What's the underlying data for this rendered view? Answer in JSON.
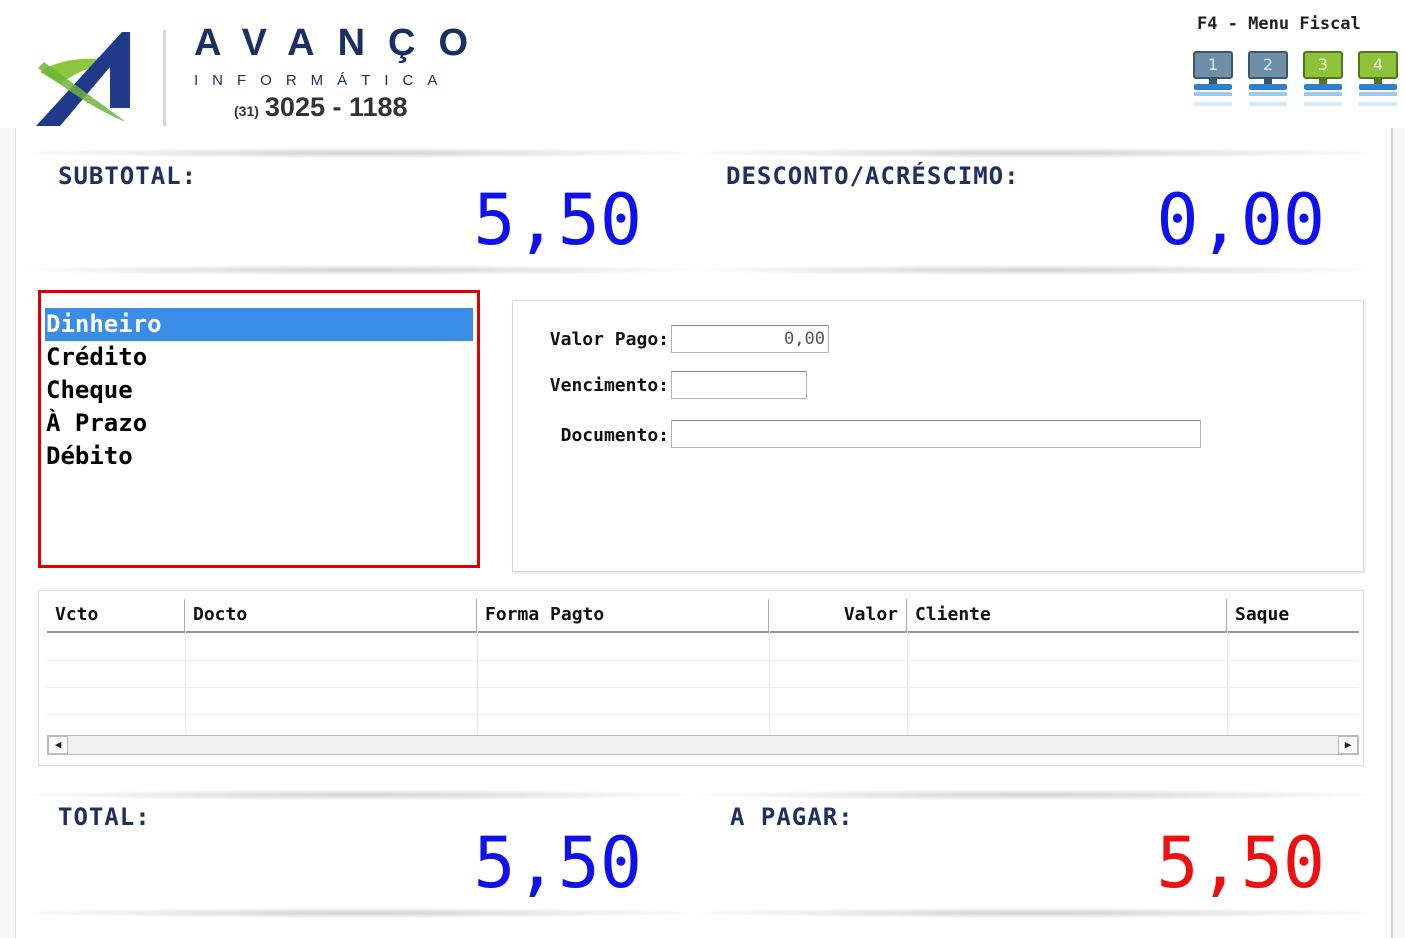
{
  "header": {
    "brand_name": "AVANÇO",
    "brand_sub": "INFORMÁTICA",
    "phone_ddd": "(31)",
    "phone_number": "3025 - 1188",
    "fiscal_menu_label": "F4 - Menu Fiscal",
    "monitors": [
      {
        "label": "1",
        "color": "#6f8fa8"
      },
      {
        "label": "2",
        "color": "#6f8fa8"
      },
      {
        "label": "3",
        "color": "#8fc23a"
      },
      {
        "label": "4",
        "color": "#8fc23a"
      }
    ]
  },
  "summary": {
    "subtotal_label": "SUBTOTAL:",
    "subtotal_value": "5,50",
    "discount_label": "DESCONTO/ACRÉSCIMO:",
    "discount_value": "0,00",
    "total_label": "TOTAL:",
    "total_value": "5,50",
    "to_pay_label": "A PAGAR:",
    "to_pay_value": "5,50"
  },
  "payment_methods": {
    "selected": "Dinheiro",
    "items": [
      "Dinheiro",
      "Crédito",
      "Cheque",
      "À Prazo",
      "Débito"
    ]
  },
  "fields": {
    "valor_pago_label": "Valor Pago:",
    "valor_pago_value": "0,00",
    "vencimento_label": "Vencimento:",
    "vencimento_value": "",
    "documento_label": "Documento:",
    "documento_value": ""
  },
  "grid": {
    "columns": [
      "Vcto",
      "Docto",
      "Forma Pagto",
      "Valor",
      "Cliente",
      "Saque"
    ],
    "rows": []
  },
  "colors": {
    "value_blue": "#1010ee",
    "value_red": "#ee1010",
    "selection": "#3a8de6",
    "highlight_border": "#e00000",
    "brand_navy": "#1a2f66"
  }
}
